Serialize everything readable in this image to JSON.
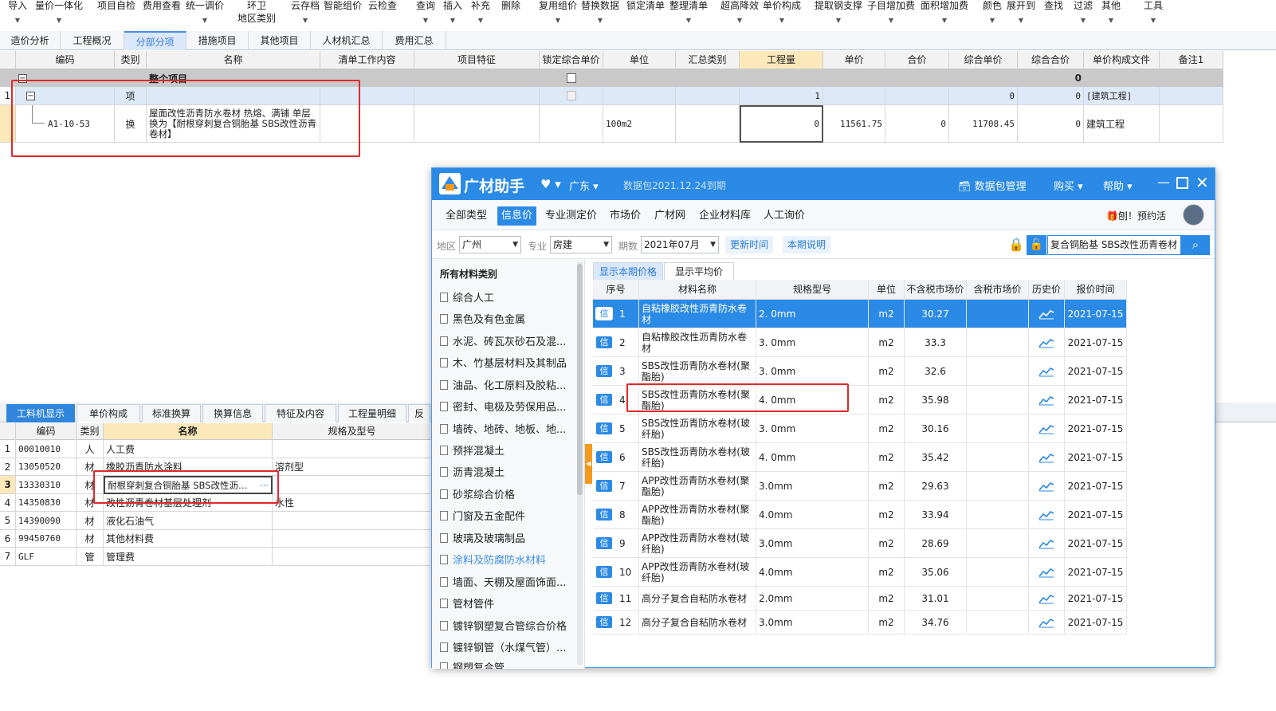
{
  "toolbar": {
    "items": [
      "导入",
      "量价一体化",
      "项目自检",
      "费用查看",
      "统一调价",
      "环卫",
      "地区类别",
      "云存档",
      "智能组价",
      "云检查",
      "查询",
      "插入",
      "补充",
      "删除",
      "复用组价",
      "替换数据",
      "锁定清单",
      "整理清单",
      "超高降效",
      "单价构成",
      "提取钢支撑",
      "子目增加费",
      "面积增加费",
      "颜色",
      "展开到",
      "查找",
      "过滤",
      "其他",
      "工具"
    ]
  },
  "tabs": [
    "造价分析",
    "工程概况",
    "分部分项",
    "措施项目",
    "其他项目",
    "人材机汇总",
    "费用汇总"
  ],
  "grid": {
    "headers": [
      "编码",
      "类别",
      "名称",
      "清单工作内容",
      "项目特征",
      "锁定综合单价",
      "单位",
      "汇总类别",
      "工程量",
      "单价",
      "合价",
      "综合单价",
      "综合合价",
      "单价构成文件",
      "备注1"
    ],
    "total_row": {
      "name": "整个项目",
      "total": "0",
      "expand": "−"
    },
    "row1": {
      "no": "1",
      "expand": "−",
      "type": "项",
      "qty": "1",
      "total": "0",
      "combined_total": "0",
      "file": "[建筑工程]"
    },
    "row2": {
      "code": "A1-10-53",
      "type": "换",
      "name": "屋面改性沥青防水卷材 热熔、满铺 单层 换为【耐根穿刺复合铜胎基 SBS改性沥青卷材】",
      "unit": "100m2",
      "qty": "0",
      "price": "11561.75",
      "total": "0",
      "combined_price": "11708.45",
      "combined_total": "0",
      "file": "建筑工程"
    }
  },
  "bottom": {
    "tabs": [
      "工料机显示",
      "单价构成",
      "标准换算",
      "换算信息",
      "特征及内容",
      "工程量明细",
      "反"
    ],
    "headers": [
      "编码",
      "类别",
      "名称",
      "规格及型号"
    ],
    "rows": [
      {
        "no": "1",
        "code": "00010010",
        "type": "人",
        "name": "人工费",
        "spec": ""
      },
      {
        "no": "2",
        "code": "13050520",
        "type": "材",
        "name": "橡胶沥青防水涂料",
        "spec": "溶剂型"
      },
      {
        "no": "3",
        "code": "13330310",
        "type": "材",
        "name": "耐根穿刺复合铜胎基 SBS改性沥…",
        "spec": ""
      },
      {
        "no": "4",
        "code": "14350830",
        "type": "材",
        "name": "改性沥青卷材基层处理剂",
        "spec": "水性"
      },
      {
        "no": "5",
        "code": "14390090",
        "type": "材",
        "name": "液化石油气",
        "spec": ""
      },
      {
        "no": "6",
        "code": "99450760",
        "type": "材",
        "name": "其他材料费",
        "spec": ""
      },
      {
        "no": "7",
        "code": "GLF",
        "type": "管",
        "name": "管理费",
        "spec": ""
      }
    ],
    "ellipsis": "···"
  },
  "popup": {
    "logo": "广材助手",
    "region": "广东",
    "package_note": "数据包2021.12.24到期",
    "data_mgmt": "数据包管理",
    "buy": "购买",
    "help": "帮助",
    "nav": [
      "全部类型",
      "信息价",
      "专业测定价",
      "市场价",
      "广材网",
      "企业材料库",
      "人工询价"
    ],
    "promo": "刨！预约活",
    "filter": {
      "region_label": "地区",
      "region": "广州",
      "major_label": "专业",
      "major": "房建",
      "period_label": "期数",
      "period": "2021年07月",
      "update_time": "更新时间",
      "period_note": "本期说明",
      "search": "复合铜胎基 SBS改性沥青卷材"
    },
    "cat_title": "所有材料类别",
    "categories": [
      "综合人工",
      "黑色及有色金属",
      "水泥、砖瓦灰砂石及混...",
      "木、竹基层材料及其制品",
      "油品、化工原料及胶粘...",
      "密封、电极及劳保用品...",
      "墙砖、地砖、地板、地...",
      "预拌混凝土",
      "沥青混凝土",
      "砂浆综合价格",
      "门窗及五金配件",
      "玻璃及玻璃制品",
      "涂料及防腐防水材料",
      "墙面、天棚及屋面饰面...",
      "管材管件",
      "镀锌钢塑复合管综合价格",
      "镀锌钢管（水煤气管）...",
      "钢塑复合管"
    ],
    "price_tabs": [
      "显示本期价格",
      "显示平均价"
    ],
    "headers": [
      "序号",
      "材料名称",
      "规格型号",
      "单位",
      "不含税市场价",
      "含税市场价",
      "历史价",
      "报价时间"
    ],
    "badge": "信",
    "rows": [
      {
        "no": "1",
        "name": "自粘橡胶改性沥青防水卷材",
        "spec": "2. 0mm",
        "unit": "m2",
        "price": "30.27",
        "date": "2021-07-15"
      },
      {
        "no": "2",
        "name": "自粘橡胶改性沥青防水卷材",
        "spec": "3. 0mm",
        "unit": "m2",
        "price": "33.3",
        "date": "2021-07-15"
      },
      {
        "no": "3",
        "name": "SBS改性沥青防水卷材(聚酯胎)",
        "spec": "3. 0mm",
        "unit": "m2",
        "price": "32.6",
        "date": "2021-07-15"
      },
      {
        "no": "4",
        "name": "SBS改性沥青防水卷材(聚酯胎)",
        "spec": "4. 0mm",
        "unit": "m2",
        "price": "35.98",
        "date": "2021-07-15"
      },
      {
        "no": "5",
        "name": "SBS改性沥青防水卷材(玻纤胎)",
        "spec": "3. 0mm",
        "unit": "m2",
        "price": "30.16",
        "date": "2021-07-15"
      },
      {
        "no": "6",
        "name": "SBS改性沥青防水卷材(玻纤胎)",
        "spec": "4. 0mm",
        "unit": "m2",
        "price": "35.42",
        "date": "2021-07-15"
      },
      {
        "no": "7",
        "name": "APP改性沥青防水卷材(聚酯胎)",
        "spec": "3.0mm",
        "unit": "m2",
        "price": "29.63",
        "date": "2021-07-15"
      },
      {
        "no": "8",
        "name": "APP改性沥青防水卷材(聚酯胎)",
        "spec": "4.0mm",
        "unit": "m2",
        "price": "33.94",
        "date": "2021-07-15"
      },
      {
        "no": "9",
        "name": "APP改性沥青防水卷材(玻纤胎)",
        "spec": "3.0mm",
        "unit": "m2",
        "price": "28.69",
        "date": "2021-07-15"
      },
      {
        "no": "10",
        "name": "APP改性沥青防水卷材(玻纤胎)",
        "spec": "4.0mm",
        "unit": "m2",
        "price": "35.06",
        "date": "2021-07-15"
      },
      {
        "no": "11",
        "name": "高分子复合自粘防水卷材",
        "spec": "2.0mm",
        "unit": "m2",
        "price": "31.01",
        "date": "2021-07-15"
      },
      {
        "no": "12",
        "name": "高分子复合自粘防水卷材",
        "spec": "3.0mm",
        "unit": "m2",
        "price": "34.76",
        "date": "2021-07-15"
      }
    ]
  },
  "colors": {
    "accent": "#2b8ae6",
    "highlight_box": "#e0292a",
    "header_hl": "#fce8b9"
  }
}
